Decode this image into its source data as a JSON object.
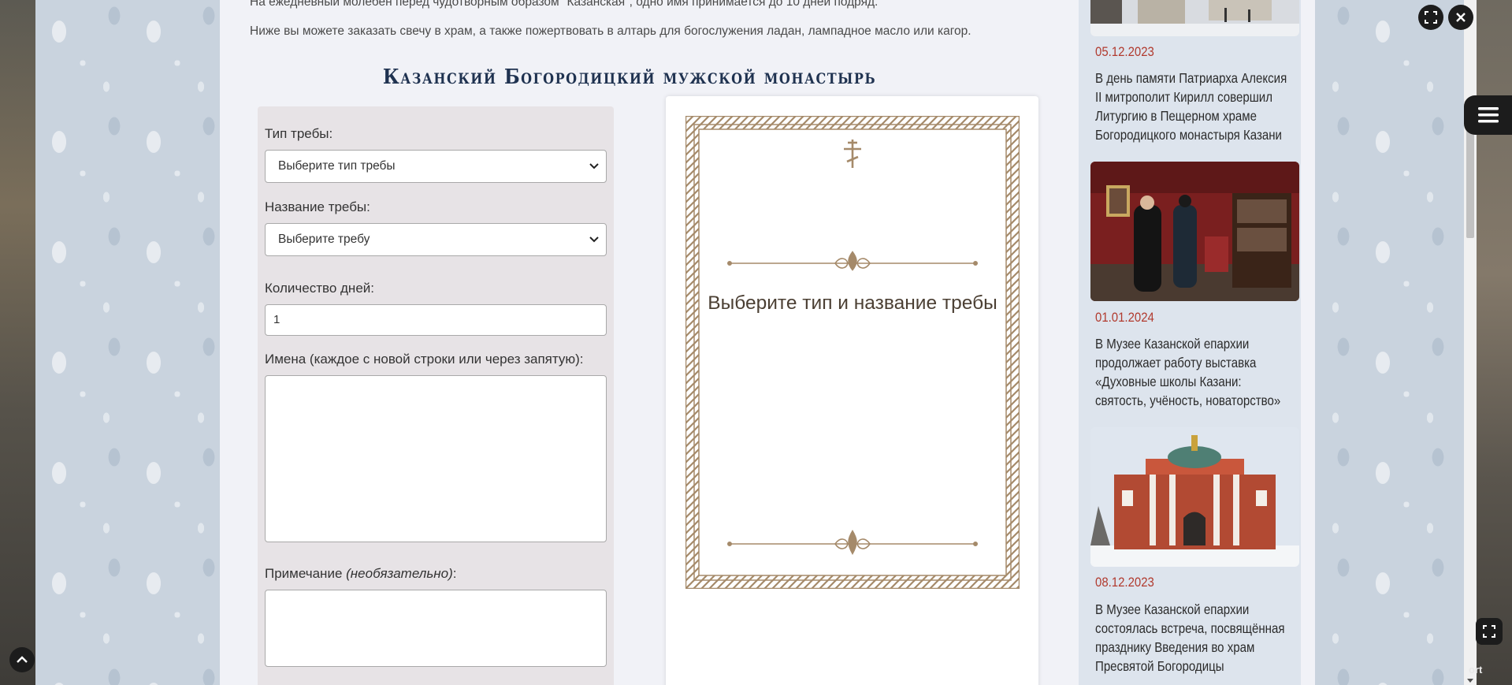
{
  "intro": {
    "line1": "На ежедневный молебен перед чудотворным образом \"Казанская\", одно имя принимается до 10 дней подряд.",
    "line2": "Ниже вы можете заказать свечу в храм, а также пожертвовать в алтарь для богослужения ладан, лампадное масло или кагор."
  },
  "monastery_title": "Казанский Богородицкий мужской монастырь",
  "form": {
    "type_label": "Тип требы:",
    "type_placeholder": "Выберите тип требы",
    "name_label": "Название требы:",
    "name_placeholder": "Выберите требу",
    "days_label": "Количество дней:",
    "days_value": "1",
    "names_label": "Имена (каждое с новой строки или через запятую):",
    "note_label": "Примечание",
    "note_optional": "(необязательно)",
    "note_colon": ":"
  },
  "preview": {
    "text": "Выберите тип и название требы"
  },
  "news": [
    {
      "date": "05.12.2023",
      "title": "В день памяти Патриарха Алексия II митрополит Кирилл совершил Литургию в Пещерном храме Богородицкого монастыря Казани"
    },
    {
      "date": "01.01.2024",
      "title": "В Музее Казанской епархии продолжает работу выставка «Духовные школы Казани: святость, учёность, новаторство»"
    },
    {
      "date": "08.12.2023",
      "title": "В Музее Казанской епархии состоялась встреча, посвящённая празднику Введения во храм Пресвятой Богородицы"
    }
  ],
  "overlay": {
    "corner_text": "ort"
  },
  "colors": {
    "date_red": "#b13a2e",
    "title_navy": "#1f3250",
    "frame_brown": "#a58a6a"
  }
}
